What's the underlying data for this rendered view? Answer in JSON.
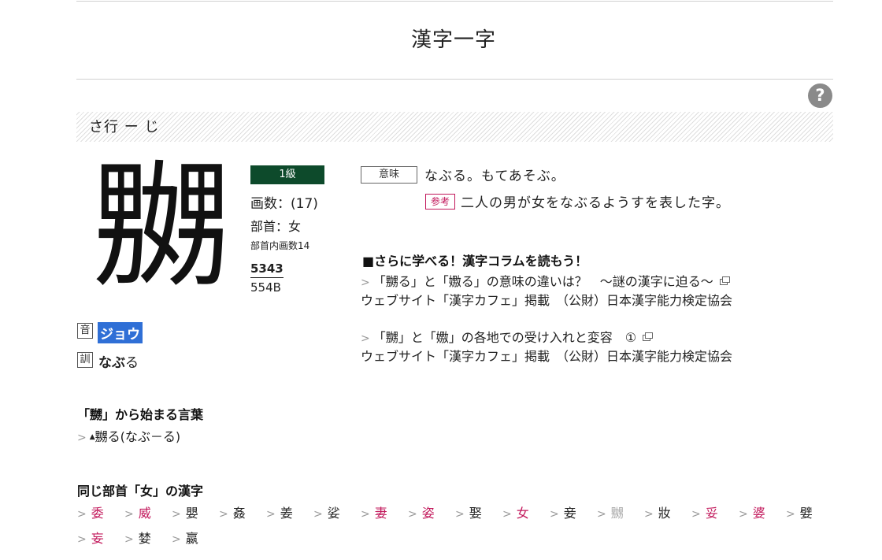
{
  "page": {
    "title": "漢字一字",
    "help": "?"
  },
  "banner": {
    "text": "さ行 ー じ"
  },
  "kanji": {
    "character": "嬲",
    "grade": "1級",
    "stroke_count": "画数：(17)",
    "radical": "部首：女",
    "radical_strokes": "部首内画数14",
    "code1": "5343",
    "code2": "554B",
    "on_label": "音",
    "on_reading": "ジョウ",
    "kun_label": "訓",
    "kun_reading_bold": "なぶ",
    "kun_reading_okurigana": "る"
  },
  "meaning": {
    "label": "意味",
    "text": "なぶる。もてあそぶ。",
    "ref_label": "参考",
    "ref_text": "二人の男が女をなぶるようすを表した字。"
  },
  "column": {
    "heading": "■さらに学べる！漢字コラムを読もう！",
    "items": [
      {
        "title": "「嬲る」と「嫐る」の意味の違いは？　～謎の漢字に迫る～",
        "source": "ウェブサイト「漢字カフェ」掲載　（公財）日本漢字能力検定協会"
      },
      {
        "title": "「嬲」と「嫐」の各地での受け入れと変容　①",
        "source": "ウェブサイト「漢字カフェ」掲載　（公財）日本漢字能力検定協会"
      }
    ]
  },
  "words": {
    "heading": "「嬲」から始まる言葉",
    "mark": "▲",
    "items": [
      "嬲る(なぶ－る)"
    ]
  },
  "same_radical": {
    "heading": "同じ部首「女」の漢字",
    "row1": [
      {
        "char": "委",
        "color": "pink"
      },
      {
        "char": "威",
        "color": "pink"
      },
      {
        "char": "嬰",
        "color": "black"
      },
      {
        "char": "姦",
        "color": "black"
      },
      {
        "char": "姜",
        "color": "black"
      },
      {
        "char": "娑",
        "color": "black"
      },
      {
        "char": "妻",
        "color": "pink"
      },
      {
        "char": "姿",
        "color": "pink"
      },
      {
        "char": "娶",
        "color": "black"
      },
      {
        "char": "女",
        "color": "pink"
      },
      {
        "char": "妾",
        "color": "black"
      },
      {
        "char": "嬲",
        "color": "gray"
      },
      {
        "char": "妝",
        "color": "black"
      },
      {
        "char": "妥",
        "color": "pink"
      },
      {
        "char": "婆",
        "color": "pink"
      },
      {
        "char": "嬖",
        "color": "black"
      }
    ],
    "row2": [
      {
        "char": "妄",
        "color": "pink"
      },
      {
        "char": "婪",
        "color": "black"
      },
      {
        "char": "嬴",
        "color": "black"
      }
    ]
  }
}
